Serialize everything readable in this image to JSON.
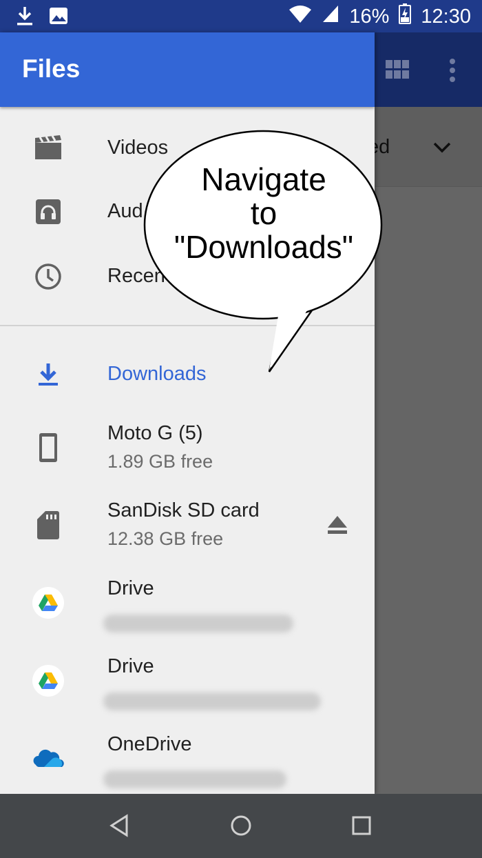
{
  "status_bar": {
    "battery": "16%",
    "time": "12:30",
    "icons": [
      "download-icon",
      "image-icon",
      "wifi-icon",
      "signal-icon",
      "battery-charging-icon"
    ]
  },
  "background_app": {
    "sort_label": "ed",
    "icons": [
      "grid-view-icon",
      "more-vert-icon",
      "chevron-down-icon"
    ]
  },
  "drawer": {
    "title": "Files",
    "items": [
      {
        "label": "Videos",
        "icon": "video-icon"
      },
      {
        "label": "Aud",
        "icon": "audio-icon"
      },
      {
        "label": "Recen",
        "icon": "clock-icon"
      }
    ],
    "locations": [
      {
        "label": "Downloads",
        "icon": "download-icon",
        "selected": true
      },
      {
        "label": "Moto G (5)",
        "sub": "1.89 GB free",
        "icon": "phone-icon"
      },
      {
        "label": "SanDisk SD card",
        "sub": "12.38 GB free",
        "icon": "sd-card-icon",
        "action_icon": "eject-icon"
      },
      {
        "label": "Drive",
        "icon": "google-drive-icon"
      },
      {
        "label": "Drive",
        "icon": "google-drive-icon"
      },
      {
        "label": "OneDrive",
        "icon": "onedrive-icon"
      }
    ]
  },
  "bubble": {
    "lines": [
      "Navigate",
      "to",
      "\"Downloads\""
    ]
  },
  "nav_bar": {
    "icons": [
      "back-icon",
      "home-icon",
      "recents-icon"
    ]
  },
  "colors": {
    "accent": "#3366d6",
    "status_bar": "#1f3a8a",
    "drawer_bg": "#efefef",
    "scrim": "#656565",
    "nav_bar": "#44474a"
  }
}
